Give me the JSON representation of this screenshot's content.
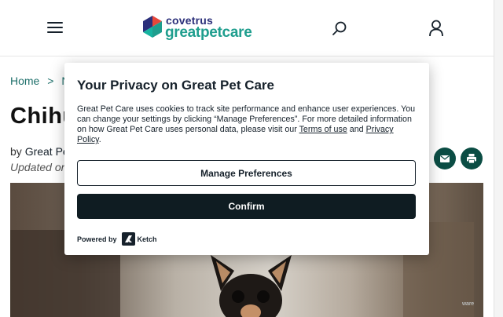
{
  "header": {
    "brand_top": "covetrus",
    "brand_main": "greatpetcare"
  },
  "breadcrumb": {
    "items": [
      "Home",
      "N"
    ],
    "separator": ">"
  },
  "page": {
    "title_visible": "Chihu",
    "byline_prefix": "by",
    "author_visible": "Great Pe",
    "updated_visible": "Updated on"
  },
  "modal": {
    "title": "Your Privacy on Great Pet Care",
    "body_text_1": "Great Pet Care uses cookies to track site performance and enhance user experiences. You can change your settings by clicking “Manage Preferences”. For more detailed information on how Great Pet Care uses personal data, please visit our ",
    "terms_link": "Terms of use",
    "body_and": " and ",
    "privacy_link": "Privacy Policy",
    "body_end": ".",
    "manage_button": "Manage Preferences",
    "confirm_button": "Confirm",
    "powered_by": "Powered by",
    "ketch_label": "Ketch"
  },
  "watermark": "ware",
  "colors": {
    "brand_teal": "#1f9e8e",
    "brand_navy": "#2b2f7a",
    "brand_red": "#e8473a",
    "dark_button": "#0f1c22",
    "share_green": "#0b4d44",
    "text_dark": "#16212b"
  },
  "icons": {
    "menu": "hamburger-icon",
    "search": "search-icon",
    "account": "user-icon",
    "email": "email-icon",
    "print": "print-icon",
    "ketch": "ketch-logo-icon"
  }
}
